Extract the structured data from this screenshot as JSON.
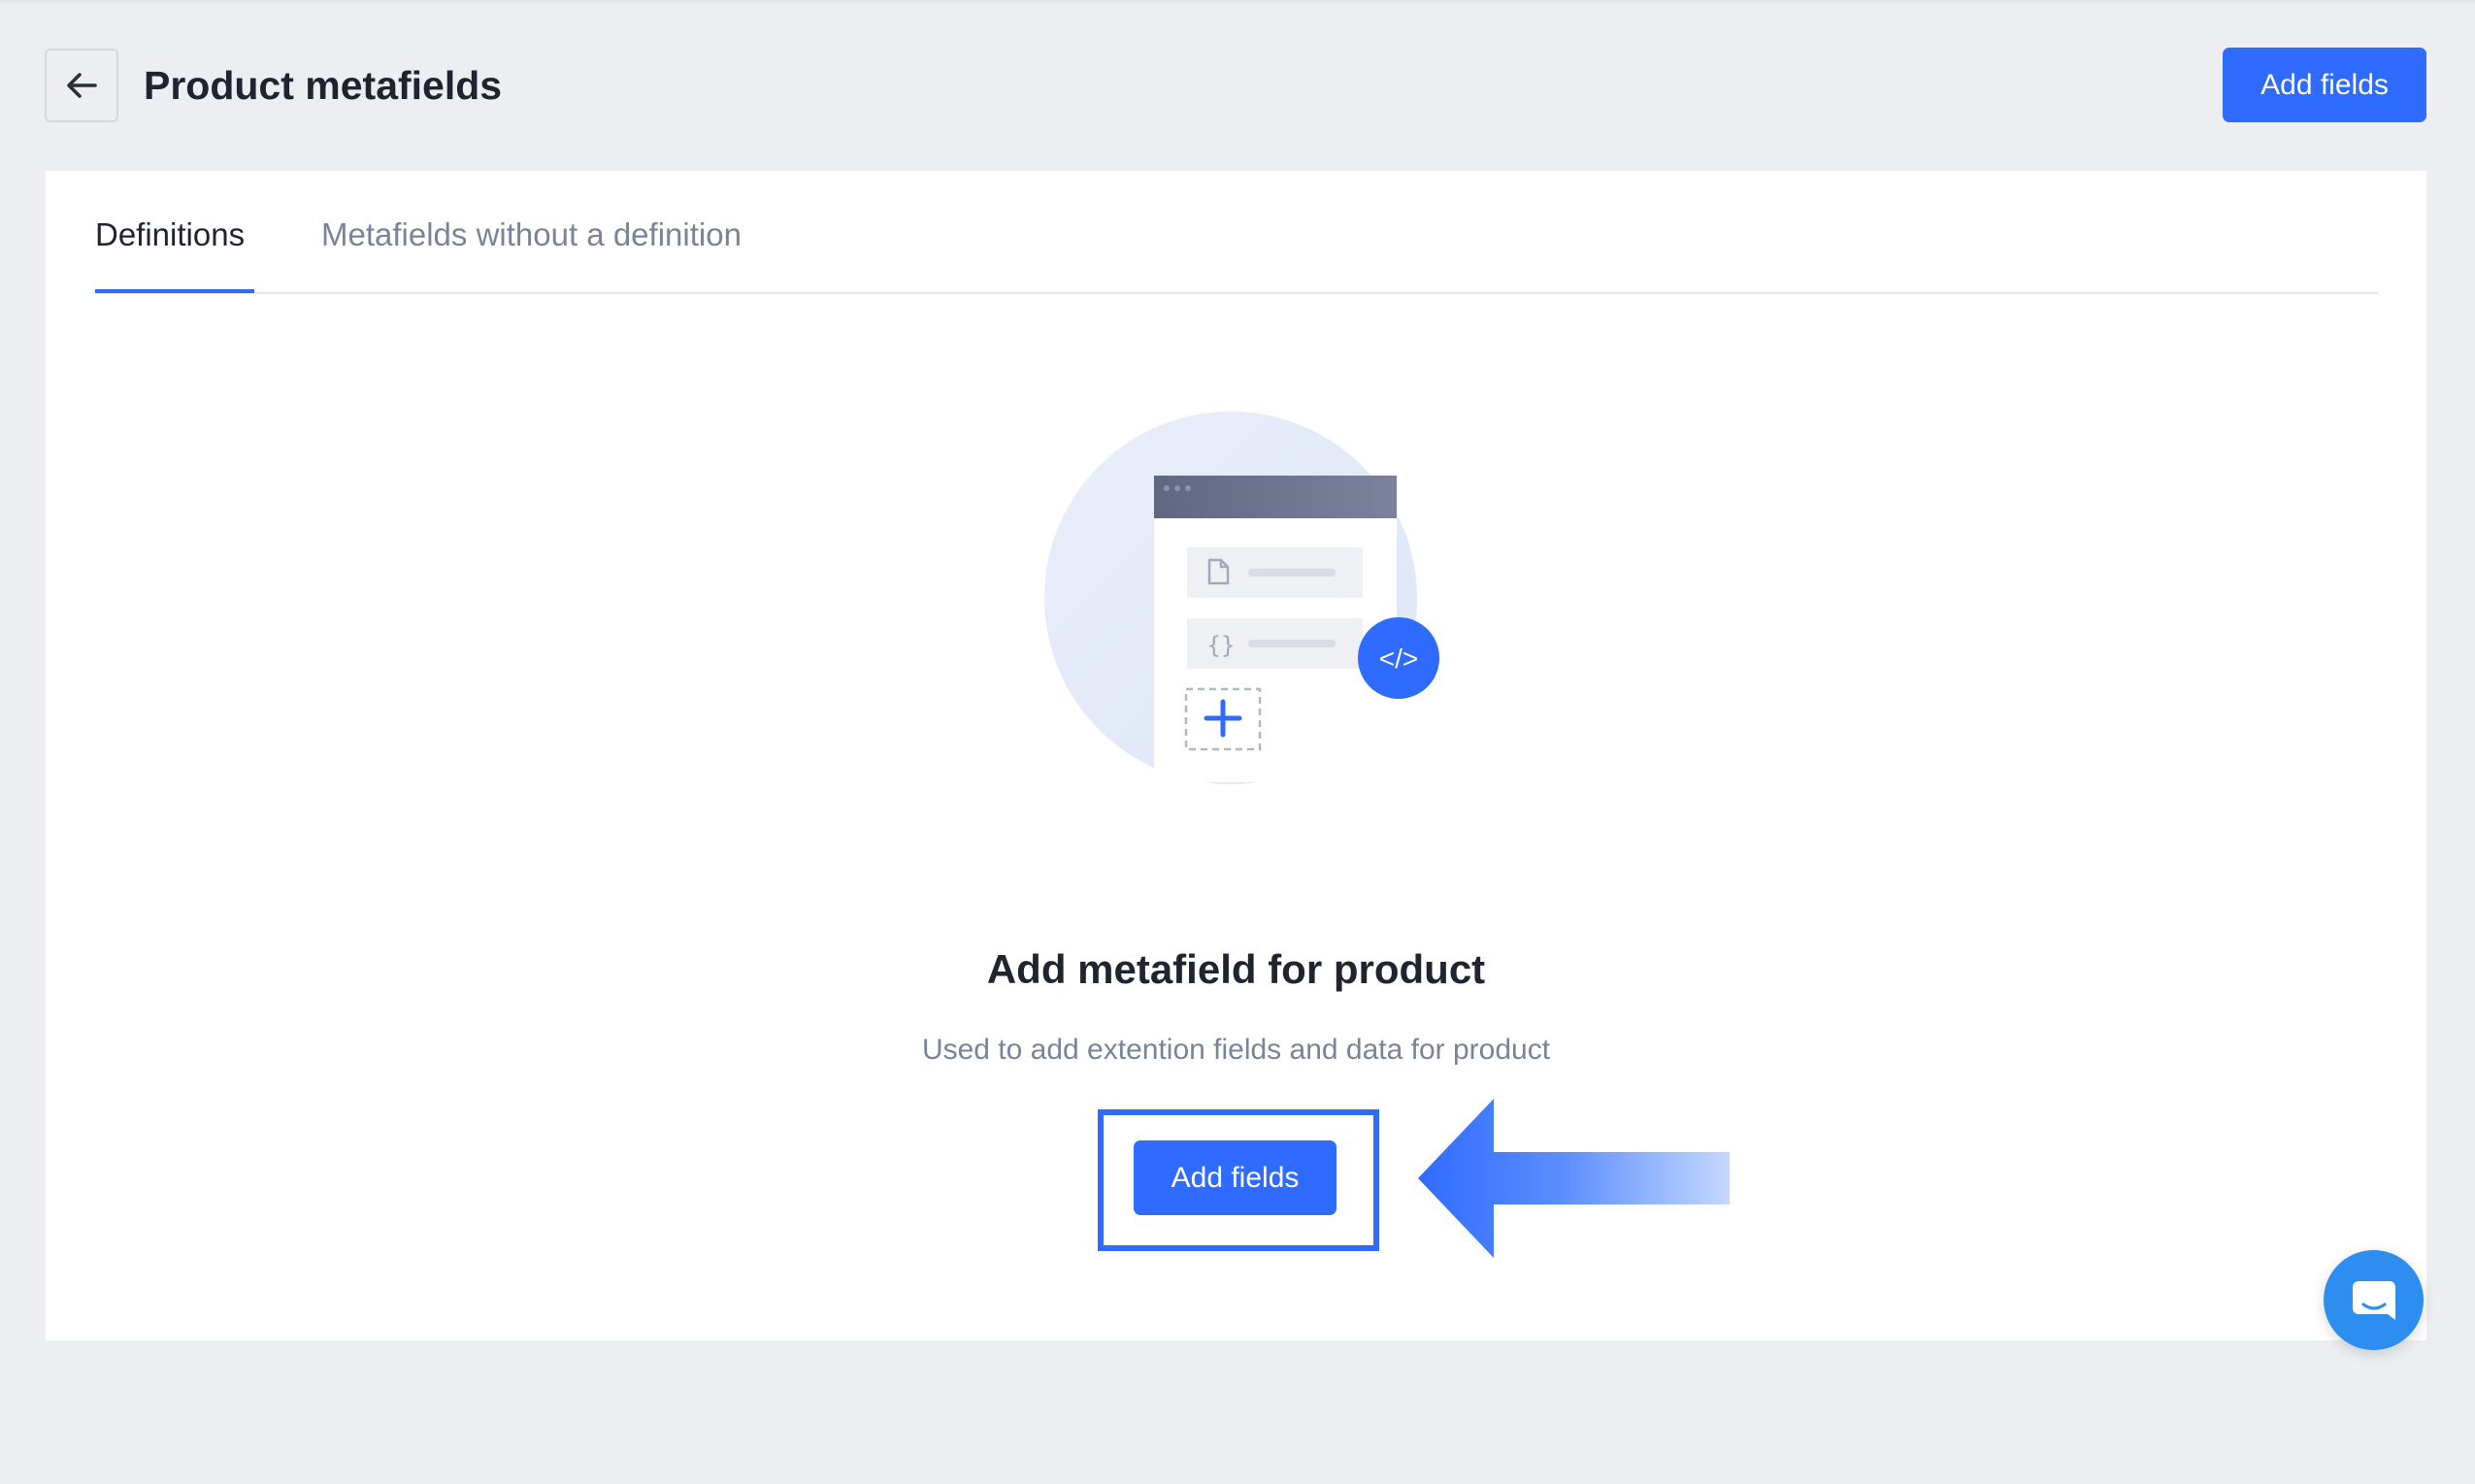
{
  "header": {
    "title": "Product metafields",
    "add_button_label": "Add fields"
  },
  "tabs": [
    {
      "label": "Definitions",
      "active": true
    },
    {
      "label": "Metafields without a definition",
      "active": false
    }
  ],
  "empty_state": {
    "title": "Add metafield for product",
    "description": "Used to add extention fields and data for product",
    "button_label": "Add fields",
    "illustration": {
      "brace_symbol": "{}",
      "code_badge": "</>"
    }
  },
  "colors": {
    "accent": "#2f6bff",
    "background": "#eceef2",
    "chat": "#2d8ef0"
  },
  "icons": {
    "back": "arrow-left-icon",
    "chat": "chat-icon",
    "annotation": "arrow-pointer-icon"
  }
}
